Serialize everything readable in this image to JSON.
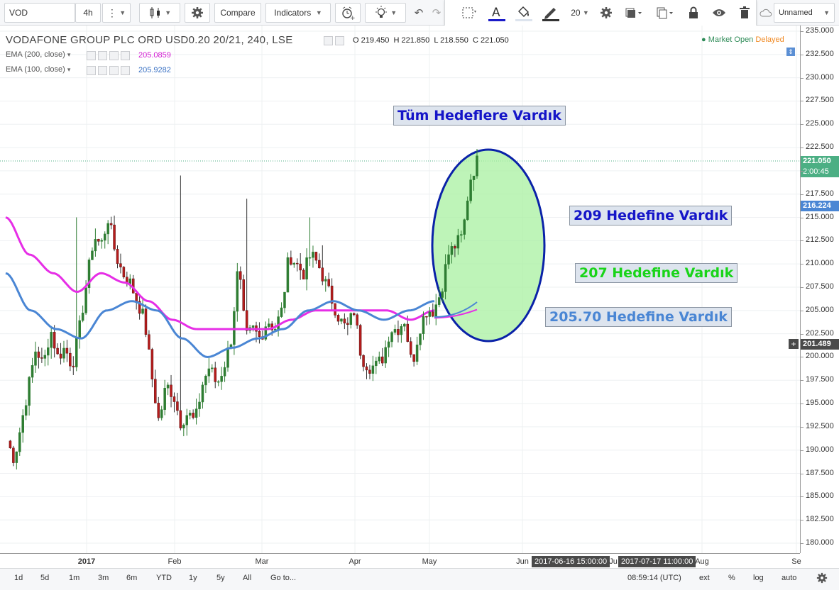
{
  "toolbar": {
    "symbol": "VOD",
    "interval": "4h",
    "compare_label": "Compare",
    "indicators_label": "Indicators",
    "font_size": "20",
    "layout_name": "Unnamed"
  },
  "legend": {
    "title": "VODAFONE GROUP PLC ORD USD0.20 20/21, 240, LSE",
    "ohlc": "O 219.450  H 221.850  L 218.550  C 221.050",
    "market_status": "Market Open",
    "delayed": "Delayed",
    "ema200_label": "EMA (200, close)",
    "ema200_value": "205.0859",
    "ema100_label": "EMA (100, close)",
    "ema100_value": "205.9282"
  },
  "annotations": {
    "all_targets": "Tüm Hedeflere Vardık",
    "target_209": "209 Hedefine Vardık",
    "target_207": "207 Hedefine Vardık",
    "target_20570": "205.70 Hedefine Vardık"
  },
  "price_axis": {
    "ticks": [
      "235.000",
      "232.500",
      "230.000",
      "227.500",
      "225.000",
      "222.500",
      "220.000",
      "217.500",
      "215.000",
      "212.500",
      "210.000",
      "207.500",
      "205.000",
      "202.500",
      "200.000",
      "197.500",
      "195.000",
      "192.500",
      "190.000",
      "187.500",
      "185.000",
      "182.500",
      "180.000"
    ],
    "last_price": "221.050",
    "countdown": "2:00:45",
    "ema_price": "216.224",
    "crosshair_price": "201.489"
  },
  "time_axis": {
    "labels": [
      "2017",
      "Feb",
      "Mar",
      "Apr",
      "May",
      "Jun",
      "Aug",
      "Se"
    ],
    "range_start": "2017-06-16 15:00:00",
    "range_end": "2017-07-17 11:00:00",
    "jul_partial": "Ju"
  },
  "bottom": {
    "ranges": [
      "1d",
      "5d",
      "1m",
      "3m",
      "6m",
      "YTD",
      "1y",
      "5y",
      "All"
    ],
    "goto": "Go to...",
    "clock": "08:59:14 (UTC)",
    "ext": "ext",
    "pct": "%",
    "log": "log",
    "auto": "auto"
  },
  "colors": {
    "up": "#2e7d32",
    "down": "#b71c1c",
    "ema200": "#e62ee6",
    "ema100": "#4a86d4",
    "ellipse_fill": "#a8f0a0",
    "ellipse_stroke": "#0a22a8",
    "ann_blue": "#1515c8",
    "ann_green": "#19d419",
    "ann_lightblue": "#4a86d4"
  },
  "chart_data": {
    "type": "candlestick",
    "title": "VODAFONE GROUP PLC ORD USD0.20 20/21, 240, LSE",
    "ylim": [
      180,
      235
    ],
    "x_labels": [
      "2017",
      "Feb",
      "Mar",
      "Apr",
      "May",
      "Jun",
      "Aug"
    ],
    "close_path": [
      191,
      189,
      193,
      197,
      201,
      199,
      203,
      200,
      201,
      199,
      203,
      208,
      213,
      212,
      215,
      211,
      209,
      208,
      206,
      204,
      198,
      193,
      197,
      196,
      193,
      194,
      193,
      197,
      199,
      197,
      199,
      202,
      210,
      202,
      203,
      202,
      204,
      203,
      205,
      211,
      210,
      209,
      211,
      210,
      208,
      206,
      204,
      203,
      205,
      200,
      199,
      199,
      200,
      203,
      203,
      204,
      199,
      203,
      205,
      205,
      207,
      211,
      212,
      213,
      219,
      221
    ],
    "ema200_path": [
      215,
      211,
      209,
      207,
      209,
      208,
      206,
      204,
      203,
      203,
      203,
      203,
      204,
      205,
      205,
      205,
      205,
      204,
      205
    ],
    "ema100_path": [
      209,
      205,
      203,
      202,
      205,
      206,
      205,
      202,
      200,
      201,
      202,
      203,
      205,
      206,
      205,
      204,
      205,
      206
    ],
    "spike_highs": [
      215,
      212.5,
      215,
      219,
      214,
      215
    ]
  }
}
